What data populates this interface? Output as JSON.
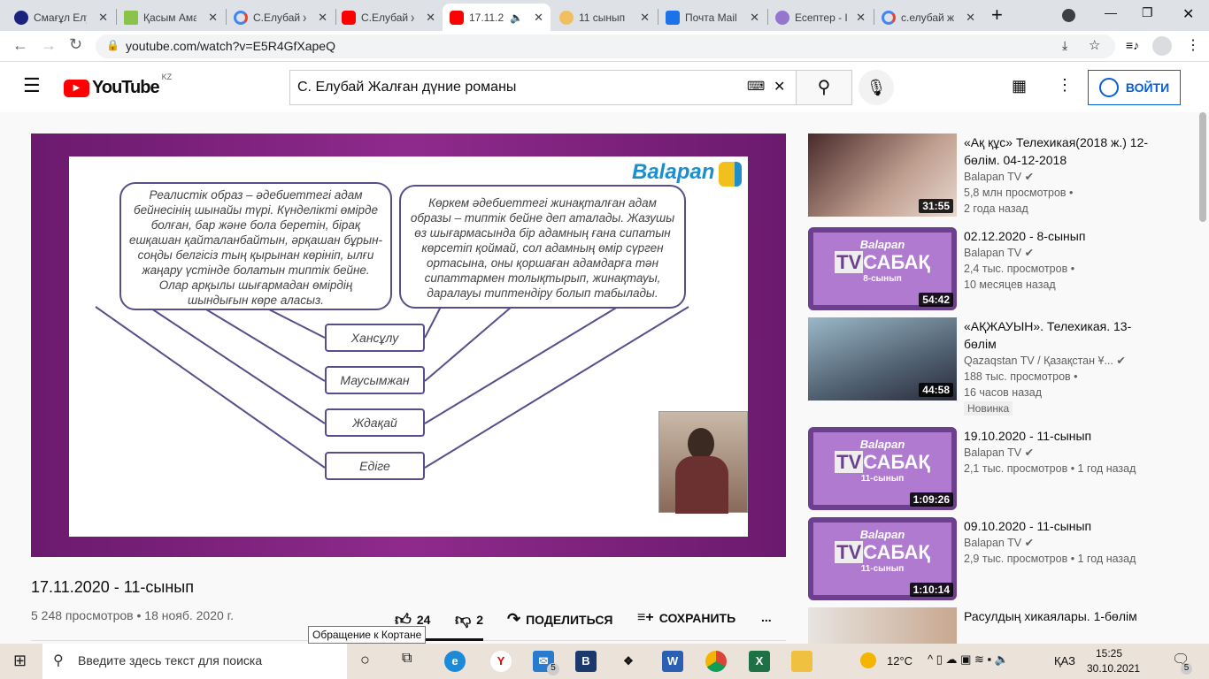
{
  "browser": {
    "tabs": [
      {
        "title": "Смағұл Елу",
        "icon": "circle-logo"
      },
      {
        "title": "Қасым Ама",
        "icon": "z-logo"
      },
      {
        "title": "С.Елубай ж",
        "icon": "google-logo"
      },
      {
        "title": "С.Елубай ж",
        "icon": "youtube-logo"
      },
      {
        "title": "17.11.2",
        "icon": "youtube-logo",
        "active": true
      },
      {
        "title": "11 сынып",
        "icon": "sun-logo"
      },
      {
        "title": "Почта Mail",
        "icon": "mail-logo"
      },
      {
        "title": "Есептер - І",
        "icon": "hand-logo"
      },
      {
        "title": "с.елубай ж",
        "icon": "google-logo"
      }
    ],
    "url": "youtube.com/watch?v=E5R4GfXapeQ"
  },
  "youtube": {
    "logo": "YouTube",
    "region": "KZ",
    "search_value": "С. Елубай Жалған дүние романы",
    "login": "ВОЙТИ"
  },
  "slide": {
    "brand": "Balapan",
    "left_text": "Реалистік образ – әдебиеттегі адам бейнесінің шынайы түрі. Күнделікті өмірде болған, бар және бола беретін, бірақ ешқашан қайталанбайтын, әрқашан бұрын-соңды белгісіз тың қырынан көрініп, ылғи жаңару үстінде болатын типтік бейне. Олар арқылы шығармадан өмірдің шындығын көре аласыз.",
    "right_text": "Көркем әдебиеттегі жинақталған адам образы – типтік бейне деп аталады. Жазушы өз шығармасында бір адамның ғана сипатын көрсетіп қоймай, сол адамның өмір сүрген ортасына, оны қоршаған адамдарға тән сипаттармен толықтырып, жинақтауы, даралауы типтендіру болып табылады.",
    "names": [
      "Хансұлу",
      "Маусымжан",
      "Ждақай",
      "Едіге"
    ]
  },
  "video": {
    "title": "17.11.2020 - 11-сынып",
    "meta": "5 248 просмотров • 18 нояб. 2020 г.",
    "likes": "24",
    "dislikes": "2",
    "share": "ПОДЕЛИТЬСЯ",
    "save": "СОХРАНИТЬ",
    "more": "...",
    "tooltip": "Обращение к Кортане"
  },
  "recommended": [
    {
      "title": "«Ақ құс» Телехикая(2018 ж.) 12-бөлім. 04-12-2018",
      "channel": "Balapan TV",
      "views": "5,8 млн просмотров •",
      "age": "2 года назад",
      "duration": "31:55"
    },
    {
      "title": "02.12.2020 - 8-сынып",
      "channel": "Balapan TV",
      "views": "2,4 тыс. просмотров •",
      "age": "10 месяцев назад",
      "duration": "54:42",
      "grade": "8-сынып"
    },
    {
      "title": "«АҚЖАУЫН». Телехикая. 13-бөлім",
      "channel": "Qazaqstan TV / Қазақстан Ұ...",
      "views": "188 тыс. просмотров •",
      "age": "16 часов назад",
      "duration": "44:58",
      "badge": "Новинка"
    },
    {
      "title": "19.10.2020 - 11-сынып",
      "channel": "Balapan TV",
      "views": "2,1 тыс. просмотров • 1 год назад",
      "duration": "1:09:26",
      "grade": "11-сынып"
    },
    {
      "title": "09.10.2020 - 11-сынып",
      "channel": "Balapan TV",
      "views": "2,9 тыс. просмотров • 1 год назад",
      "duration": "1:10:14",
      "grade": "11-сынып"
    },
    {
      "title": "Расулдың хикаялары. 1-бөлім"
    }
  ],
  "sabak": {
    "brand": "Balapan",
    "tv": "TV",
    "word": "САБАҚ"
  },
  "taskbar": {
    "search_placeholder": "Введите здесь текст для поиска",
    "temp": "12°C",
    "lang": "ҚАЗ",
    "time": "15:25",
    "date": "30.10.2021",
    "mail_badge": "5",
    "notif_badge": "5"
  }
}
